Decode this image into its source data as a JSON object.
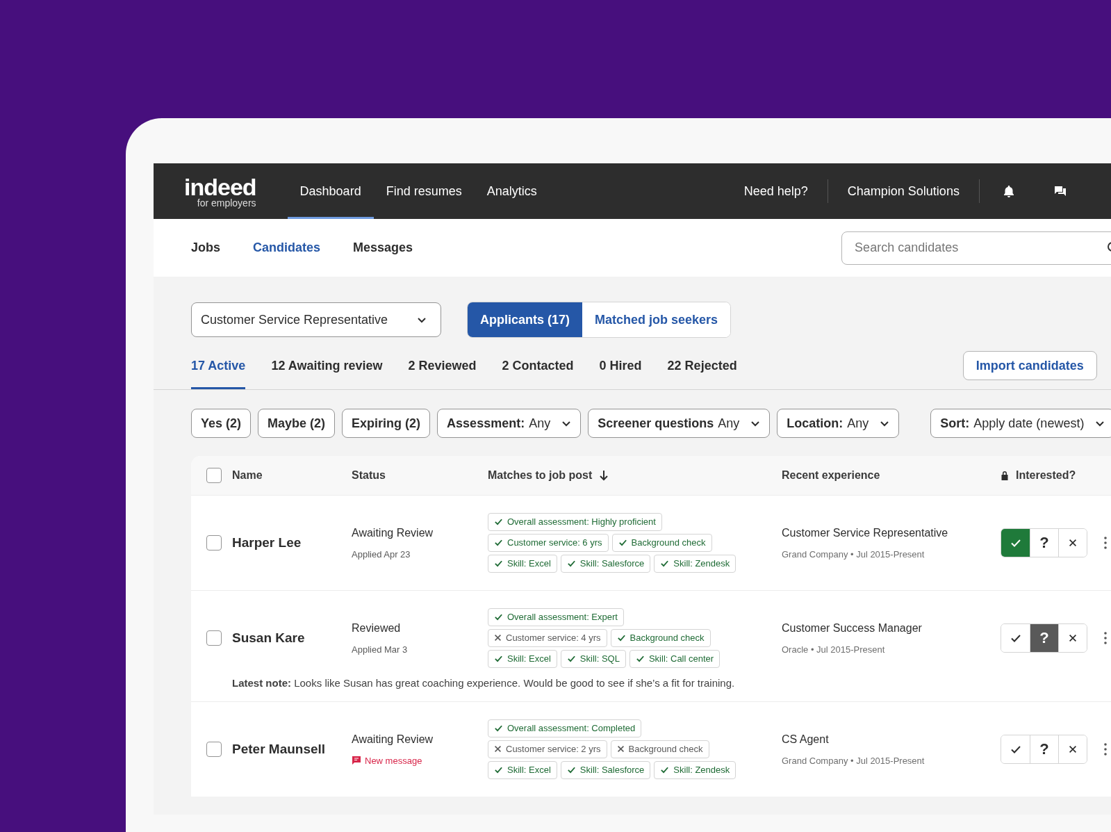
{
  "header": {
    "logo": {
      "wordmark": "indeed",
      "tagline": "for employers"
    },
    "nav": [
      {
        "label": "Dashboard",
        "selected": true
      },
      {
        "label": "Find resumes",
        "selected": false
      },
      {
        "label": "Analytics",
        "selected": false
      }
    ],
    "help": "Need help?",
    "account": "Champion Solutions"
  },
  "subnav": {
    "tabs": [
      {
        "label": "Jobs",
        "selected": false
      },
      {
        "label": "Candidates",
        "selected": true
      },
      {
        "label": "Messages",
        "selected": false
      }
    ],
    "search": {
      "placeholder": "Search candidates"
    }
  },
  "job_select": "Customer Service Representative",
  "view_toggle": [
    {
      "label": "Applicants (17)",
      "selected": true
    },
    {
      "label": "Matched job seekers",
      "selected": false
    }
  ],
  "status_tabs": [
    {
      "label": "17 Active",
      "selected": true
    },
    {
      "label": "12 Awaiting review",
      "selected": false
    },
    {
      "label": "2 Reviewed",
      "selected": false
    },
    {
      "label": "2 Contacted",
      "selected": false
    },
    {
      "label": "0 Hired",
      "selected": false
    },
    {
      "label": "22 Rejected",
      "selected": false
    }
  ],
  "import_button": "Import candidates",
  "filters": [
    {
      "kind": "chip",
      "label": "Yes (2)"
    },
    {
      "kind": "chip",
      "label": "Maybe (2)"
    },
    {
      "kind": "chip",
      "label": "Expiring (2)"
    },
    {
      "kind": "dropdown",
      "label": "Assessment:",
      "value": "Any"
    },
    {
      "kind": "dropdown",
      "label": "Screener questions",
      "value": "Any"
    },
    {
      "kind": "dropdown",
      "label": "Location:",
      "value": "Any"
    }
  ],
  "sort": {
    "label": "Sort:",
    "value": "Apply date (newest)"
  },
  "table": {
    "select_all": {
      "checked": false
    },
    "columns": [
      {
        "label": "Name",
        "kind": "plain"
      },
      {
        "label": "Status",
        "kind": "plain"
      },
      {
        "label": "Matches to job post",
        "kind": "sorted"
      },
      {
        "label": "Recent experience",
        "kind": "plain"
      },
      {
        "label": "Interested?",
        "kind": "locked"
      }
    ],
    "rows": [
      {
        "name": "Harper Lee",
        "checked": false,
        "status": "Awaiting Review",
        "detail": {
          "kind": "date",
          "text": "Applied Apr 23"
        },
        "matches": [
          [
            {
              "text": "Overall assessment: Highly proficient",
              "met": true
            }
          ],
          [
            {
              "text": "Customer service: 6 yrs",
              "met": true
            },
            {
              "text": "Background check",
              "met": true
            }
          ],
          [
            {
              "text": "Skill: Excel",
              "met": true
            },
            {
              "text": "Skill: Salesforce",
              "met": true
            },
            {
              "text": "Skill: Zendesk",
              "met": true
            }
          ]
        ],
        "experience": {
          "title": "Customer Service Representative",
          "company": "Grand Company • Jul 2015-Present"
        },
        "interest": [
          {
            "kind": "yes",
            "selected": true
          },
          {
            "kind": "maybe",
            "label": "?",
            "selected": false
          },
          {
            "kind": "no",
            "selected": false
          }
        ]
      },
      {
        "name": "Susan Kare",
        "checked": false,
        "status": "Reviewed",
        "detail": {
          "kind": "date",
          "text": "Applied Mar 3"
        },
        "matches": [
          [
            {
              "text": "Overall assessment: Expert",
              "met": true
            }
          ],
          [
            {
              "text": "Customer service: 4 yrs",
              "met": false
            },
            {
              "text": "Background check",
              "met": true
            }
          ],
          [
            {
              "text": "Skill: Excel",
              "met": true
            },
            {
              "text": "Skill: SQL",
              "met": true
            },
            {
              "text": "Skill: Call center",
              "met": true
            }
          ]
        ],
        "experience": {
          "title": "Customer Success Manager",
          "company": "Oracle • Jul 2015-Present"
        },
        "interest": [
          {
            "kind": "yes",
            "selected": false
          },
          {
            "kind": "maybe",
            "label": "?",
            "selected": true
          },
          {
            "kind": "no",
            "selected": false
          }
        ],
        "note": "**Latest note:** Looks like Susan has great coaching experience. Would be good to see if she’s a fit for training."
      },
      {
        "name": "Peter Maunsell",
        "checked": false,
        "status": "Awaiting Review",
        "detail": {
          "kind": "message",
          "text": "New message"
        },
        "matches": [
          [
            {
              "text": "Overall assessment: Completed",
              "met": true
            }
          ],
          [
            {
              "text": "Customer service: 2 yrs",
              "met": false
            },
            {
              "text": "Background check",
              "met": false
            }
          ],
          [
            {
              "text": "Skill: Excel",
              "met": true
            },
            {
              "text": "Skill: Salesforce",
              "met": true
            },
            {
              "text": "Skill: Zendesk",
              "met": true
            }
          ]
        ],
        "experience": {
          "title": "CS Agent",
          "company": "Grand Company • Jul 2015-Present"
        },
        "interest": [
          {
            "kind": "yes",
            "selected": false
          },
          {
            "kind": "maybe",
            "label": "?",
            "selected": false
          },
          {
            "kind": "no",
            "selected": false
          }
        ]
      }
    ]
  }
}
